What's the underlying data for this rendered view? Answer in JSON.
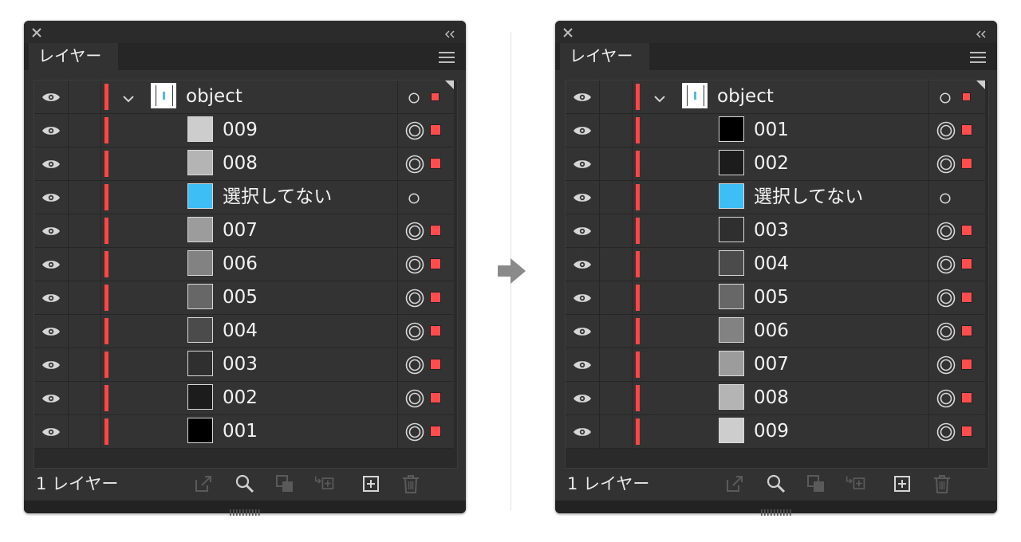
{
  "panels": [
    {
      "tab_label": "レイヤー",
      "status": "1 レイヤー",
      "layer": {
        "name": "object",
        "expanded": true,
        "color": "#ff4444"
      },
      "items": [
        {
          "name": "009",
          "swatch": "#cdcdcd",
          "selected": true
        },
        {
          "name": "008",
          "swatch": "#b4b4b4",
          "selected": true
        },
        {
          "name": "選択してない",
          "swatch": "#3dbff5",
          "selected": false
        },
        {
          "name": "007",
          "swatch": "#9c9c9c",
          "selected": true
        },
        {
          "name": "006",
          "swatch": "#828282",
          "selected": true
        },
        {
          "name": "005",
          "swatch": "#676767",
          "selected": true
        },
        {
          "name": "004",
          "swatch": "#4b4b4b",
          "selected": true
        },
        {
          "name": "003",
          "swatch": "#2f2f2f",
          "selected": true
        },
        {
          "name": "002",
          "swatch": "#1c1c1c",
          "selected": true
        },
        {
          "name": "001",
          "swatch": "#000000",
          "selected": true
        }
      ]
    },
    {
      "tab_label": "レイヤー",
      "status": "1 レイヤー",
      "layer": {
        "name": "object",
        "expanded": true,
        "color": "#ff4444"
      },
      "items": [
        {
          "name": "001",
          "swatch": "#000000",
          "selected": true
        },
        {
          "name": "002",
          "swatch": "#1c1c1c",
          "selected": true
        },
        {
          "name": "選択してない",
          "swatch": "#3dbff5",
          "selected": false
        },
        {
          "name": "003",
          "swatch": "#2f2f2f",
          "selected": true
        },
        {
          "name": "004",
          "swatch": "#4b4b4b",
          "selected": true
        },
        {
          "name": "005",
          "swatch": "#676767",
          "selected": true
        },
        {
          "name": "006",
          "swatch": "#828282",
          "selected": true
        },
        {
          "name": "007",
          "swatch": "#9c9c9c",
          "selected": true
        },
        {
          "name": "008",
          "swatch": "#b4b4b4",
          "selected": true
        },
        {
          "name": "009",
          "swatch": "#cdcdcd",
          "selected": true
        }
      ]
    }
  ],
  "toolbar_icons": [
    "export-icon",
    "search-icon",
    "clipping-mask-icon",
    "move-to-layer-icon",
    "new-sublayer-icon",
    "trash-icon"
  ],
  "colors": {
    "panel_bg": "#323232",
    "row_bg": "#333333",
    "layer_color": "#ff4444",
    "selection_square": "#ff4d4d",
    "arrow": "#8a8a8a"
  }
}
